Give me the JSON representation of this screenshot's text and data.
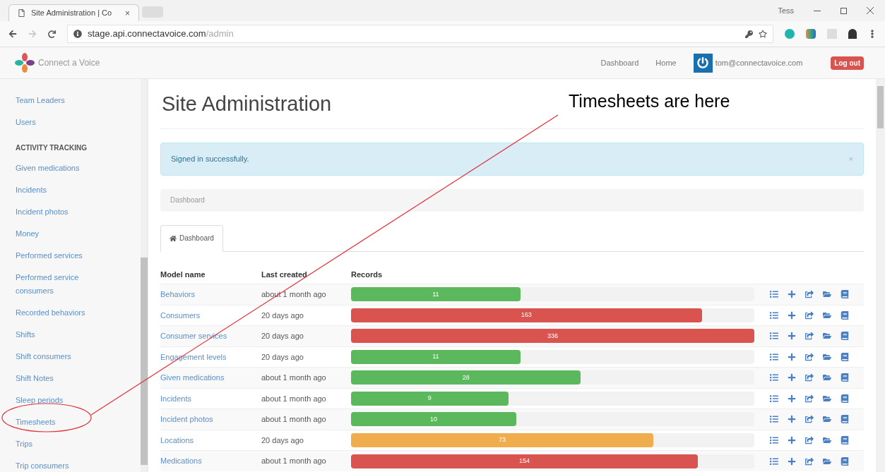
{
  "browser": {
    "tab": {
      "title": "Site Administration | Co",
      "close": "×",
      "selected": true
    },
    "profile": "Tess",
    "address": {
      "host": "stage.api.connectavoice.com",
      "path": "/admin"
    }
  },
  "navbar": {
    "brand": "Connect a Voice",
    "links": [
      "Dashboard",
      "Home"
    ],
    "user": "tom@connectavoice.com",
    "logout": "Log out"
  },
  "sidebar": {
    "items": [
      {
        "kind": "link",
        "label": "Team Leaders"
      },
      {
        "kind": "link",
        "label": "Users"
      },
      {
        "kind": "header",
        "label": "ACTIVITY TRACKING"
      },
      {
        "kind": "link",
        "label": "Given medications"
      },
      {
        "kind": "link",
        "label": "Incidents"
      },
      {
        "kind": "link",
        "label": "Incident photos"
      },
      {
        "kind": "link",
        "label": "Money"
      },
      {
        "kind": "link",
        "label": "Performed services"
      },
      {
        "kind": "link",
        "label": "Performed service consumers"
      },
      {
        "kind": "link",
        "label": "Recorded behaviors"
      },
      {
        "kind": "link",
        "label": "Shifts"
      },
      {
        "kind": "link",
        "label": "Shift consumers"
      },
      {
        "kind": "link",
        "label": "Shift Notes"
      },
      {
        "kind": "link",
        "label": "Sleep periods"
      },
      {
        "kind": "link",
        "label": "Timesheets"
      },
      {
        "kind": "link",
        "label": "Trips"
      },
      {
        "kind": "link",
        "label": "Trip consumers"
      }
    ]
  },
  "page": {
    "title": "Site Administration",
    "alert": {
      "text": "Signed in successfully.",
      "close": "×"
    },
    "breadcrumb": "Dashboard",
    "tabs": [
      {
        "label": "Dashboard",
        "selected": true
      }
    ]
  },
  "table": {
    "columns": [
      "Model name",
      "Last created",
      "Records"
    ],
    "rows": [
      {
        "name": "Behaviors",
        "last": "about 1 month ago",
        "records": "11",
        "level": 0.42,
        "kind": "success"
      },
      {
        "name": "Consumers",
        "last": "20 days ago",
        "records": "163",
        "level": 0.87,
        "kind": "danger"
      },
      {
        "name": "Consumer services",
        "last": "20 days ago",
        "records": "336",
        "level": 1,
        "kind": "danger"
      },
      {
        "name": "Engagement levels",
        "last": "20 days ago",
        "records": "11",
        "level": 0.42,
        "kind": "success"
      },
      {
        "name": "Given medications",
        "last": "about 1 month ago",
        "records": "28",
        "level": 0.57,
        "kind": "success"
      },
      {
        "name": "Incidents",
        "last": "about 1 month ago",
        "records": "9",
        "level": 0.39,
        "kind": "success"
      },
      {
        "name": "Incident photos",
        "last": "about 1 month ago",
        "records": "10",
        "level": 0.41,
        "kind": "success"
      },
      {
        "name": "Locations",
        "last": "20 days ago",
        "records": "73",
        "level": 0.75,
        "kind": "warning"
      },
      {
        "name": "Medications",
        "last": "about 1 month ago",
        "records": "154",
        "level": 0.86,
        "kind": "danger"
      }
    ]
  },
  "annotation": {
    "text": "Timesheets are here"
  }
}
